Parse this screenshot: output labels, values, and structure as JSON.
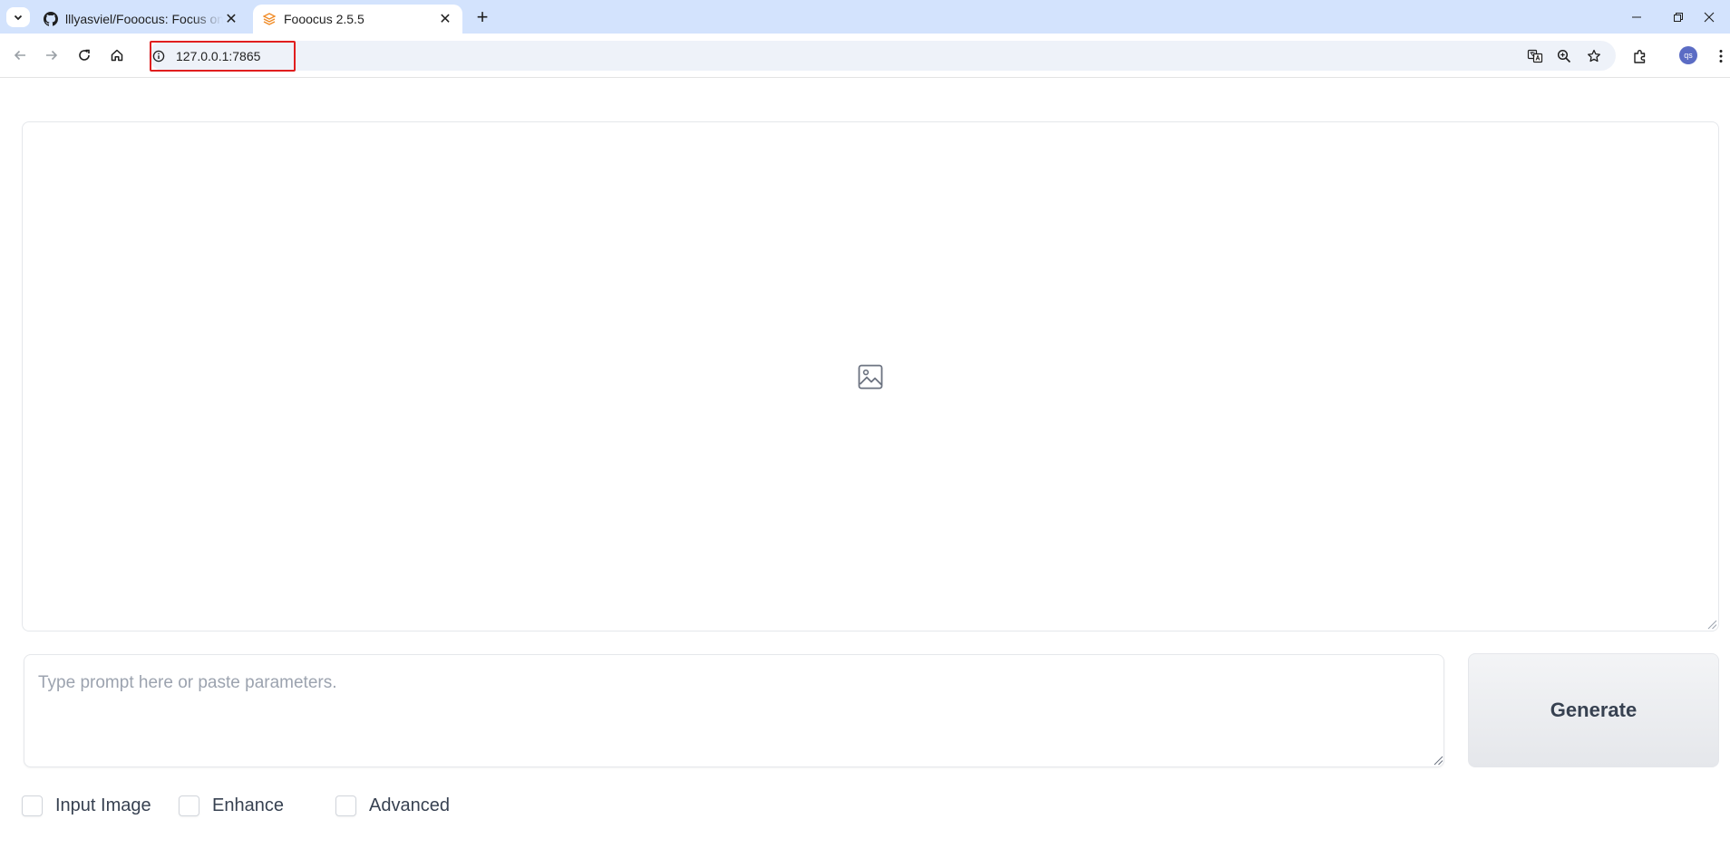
{
  "browser": {
    "tabs": [
      {
        "title": "lllyasviel/Fooocus: Focus on prompting and generating",
        "favicon": "github-icon",
        "active": false
      },
      {
        "title": "Fooocus 2.5.5",
        "favicon": "fooocus-icon",
        "active": true
      }
    ],
    "address_bar": {
      "url": "127.0.0.1:7865"
    },
    "profile_initials": "qs",
    "highlight_color": "#e01e1e"
  },
  "app": {
    "gallery": {
      "icon": "image-icon"
    },
    "prompt": {
      "placeholder": "Type prompt here or paste parameters.",
      "value": ""
    },
    "generate_label": "Generate",
    "options": [
      {
        "label": "Input Image",
        "checked": false
      },
      {
        "label": "Enhance",
        "checked": false
      },
      {
        "label": "Advanced",
        "checked": false
      }
    ]
  }
}
